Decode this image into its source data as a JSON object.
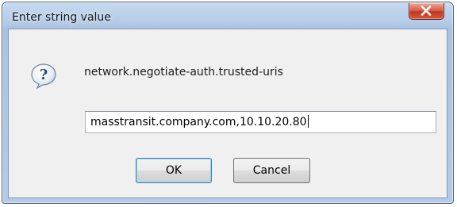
{
  "window": {
    "title": "Enter string value",
    "close_icon": "close-x-icon"
  },
  "dialog": {
    "icon": "question-icon",
    "prompt": "network.negotiate-auth.trusted-uris",
    "input_value": "masstransit.company.com,10.10.20.80",
    "ok_label": "OK",
    "cancel_label": "Cancel"
  },
  "colors": {
    "title_bar": "#b7cde8",
    "close_button": "#c2381f",
    "client_bg": "#f0f0f0",
    "default_button_border": "#3c7fb1"
  }
}
